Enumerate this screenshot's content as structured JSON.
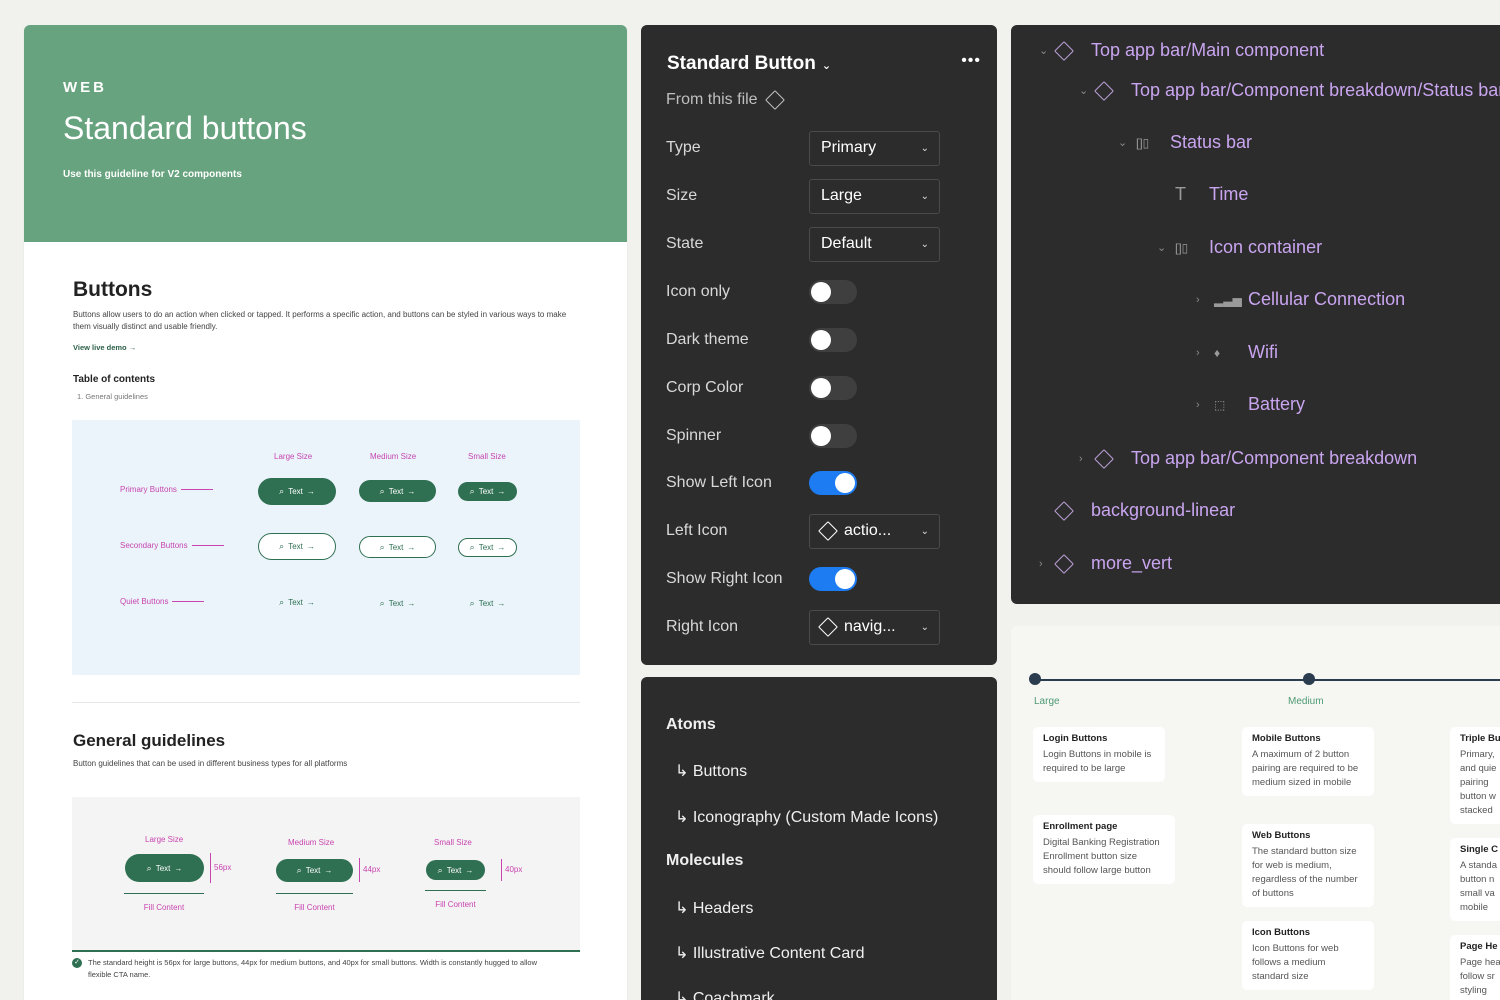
{
  "doc": {
    "eyebrow": "WEB",
    "title": "Standard buttons",
    "subtitle": "Use this guideline for V2 components",
    "buttons_heading": "Buttons",
    "buttons_desc": "Buttons allow users to do an action when clicked or tapped. It performs a specific action, and buttons can be styled in various ways to make them visually distinct and usable friendly.",
    "live_demo": "View live demo →",
    "toc_title": "Table of contents",
    "toc_items": [
      "1. General guidelines"
    ],
    "matrix": {
      "columns": [
        "Large Size",
        "Medium Size",
        "Small Size"
      ],
      "rows": [
        "Primary Buttons",
        "Secondary Buttons",
        "Quiet Buttons"
      ],
      "btn_text": "Text",
      "btn_arrow": "→",
      "search_glyph": "⌕"
    },
    "general_heading": "General guidelines",
    "general_desc": "Button guidelines that can be used in different business types for all platforms",
    "sizes": {
      "labels": [
        "Large Size",
        "Medium Size",
        "Small Size"
      ],
      "heights": [
        "56px",
        "44px",
        "40px"
      ],
      "fill": "Fill Content"
    },
    "note": "The standard height is 56px for large buttons, 44px for medium buttons, and 40px for small buttons. Width is constantly hugged to allow flexible CTA name."
  },
  "props": {
    "component": "Standard Button",
    "more": "•••",
    "source": "From this file",
    "rows": [
      {
        "label": "Type",
        "kind": "select",
        "value": "Primary"
      },
      {
        "label": "Size",
        "kind": "select",
        "value": "Large"
      },
      {
        "label": "State",
        "kind": "select",
        "value": "Default"
      },
      {
        "label": "Icon only",
        "kind": "toggle",
        "on": false
      },
      {
        "label": "Dark theme",
        "kind": "toggle",
        "on": false
      },
      {
        "label": "Corp Color",
        "kind": "toggle",
        "on": false
      },
      {
        "label": "Spinner",
        "kind": "toggle",
        "on": false
      },
      {
        "label": "Show Left Icon",
        "kind": "toggle",
        "on": true
      },
      {
        "label": "Left Icon",
        "kind": "instance",
        "value": "actio..."
      },
      {
        "label": "Show Right Icon",
        "kind": "toggle",
        "on": true
      },
      {
        "label": "Right Icon",
        "kind": "instance",
        "value": "navig..."
      }
    ]
  },
  "nav": {
    "atoms": "Atoms",
    "atoms_items": [
      "↳ Buttons",
      "↳ Iconography (Custom Made Icons)"
    ],
    "molecules": "Molecules",
    "molecules_items": [
      "↳ Headers",
      "↳ Illustrative Content Card",
      "↳ Coachmark"
    ]
  },
  "layers": [
    {
      "name": "Top app bar/Main component",
      "arrow": "⌄",
      "icon": "component-diamond-icon"
    },
    {
      "name": "Top app bar/Component breakdown/Status bar",
      "arrow": "⌄",
      "icon": "component-diamond-icon"
    },
    {
      "name": "Status bar",
      "arrow": "⌄",
      "icon": "frame-icon"
    },
    {
      "name": "Time",
      "arrow": "",
      "icon": "text-icon"
    },
    {
      "name": "Icon container",
      "arrow": "⌄",
      "icon": "frame-icon"
    },
    {
      "name": "Cellular Connection",
      "arrow": "›",
      "icon": "cellular-icon"
    },
    {
      "name": "Wifi",
      "arrow": "›",
      "icon": "wifi-icon"
    },
    {
      "name": "Battery",
      "arrow": "›",
      "icon": "battery-icon"
    },
    {
      "name": "Top app bar/Component breakdown",
      "arrow": "›",
      "icon": "component-diamond-icon"
    },
    {
      "name": "background-linear",
      "arrow": "",
      "icon": "component-diamond-icon"
    },
    {
      "name": "more_vert",
      "arrow": "›",
      "icon": "component-diamond-icon"
    }
  ],
  "guide": {
    "track_labels": [
      "Large",
      "Medium"
    ],
    "cards": [
      {
        "title": "Login Buttons",
        "body": "Login Buttons in mobile is required to be large"
      },
      {
        "title": "Enrollment page",
        "body": "Digital Banking Registration Enrollment button size should follow large button"
      },
      {
        "title": "Mobile Buttons",
        "body": "A maximum of 2 button pairing are required to be medium sized in mobile"
      },
      {
        "title": "Web Buttons",
        "body": "The standard button size for web is medium, regardless of the number of buttons"
      },
      {
        "title": "Icon Buttons",
        "body": "Icon Buttons for web follows a medium standard size"
      },
      {
        "title": "Triple Bu",
        "body": "Primary, and quie pairing button w stacked"
      },
      {
        "title": "Single C",
        "body": "A standa button n small va mobile"
      },
      {
        "title": "Page He",
        "body": "Page hea follow sr styling"
      }
    ]
  },
  "colors": {
    "hero": "#67a37e",
    "brand_green": "#2f6f52",
    "panel_dark": "#2c2c2c",
    "toggle_on": "#1d7cf2",
    "layer_purple": "#c9a5f0",
    "annotation_pink": "#c945b0"
  }
}
